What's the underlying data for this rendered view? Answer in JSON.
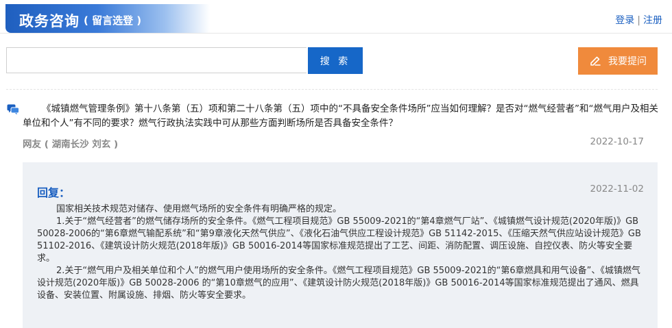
{
  "header": {
    "title": "政务咨询",
    "subtitle": "( 留言选登 )",
    "login": "登录",
    "separator": "|",
    "register": "注册"
  },
  "search": {
    "placeholder": "",
    "button_label": "搜 索"
  },
  "ask_button": {
    "label": "我要提问",
    "icon": "pencil-icon"
  },
  "question": {
    "icon": "chat-bubble-icon",
    "text": "《城镇燃气管理条例》第十八条第（五）项和第二十八条第（五）项中的“不具备安全条件场所”应当如何理解？是否对“燃气经营者”和“燃气用户及相关单位和个人”有不同的要求？燃气行政执法实践中可从那些方面判断场所是否具备安全条件？",
    "asker": "网友 ( 湖南长沙 刘玄 )",
    "date": "2022-10-17"
  },
  "reply": {
    "label": "回复：",
    "date": "2022-11-02",
    "paragraphs": [
      "国家相关技术规范对储存、使用燃气场所的安全条件有明确严格的规定。",
      "1.关于“燃气经营者”的燃气储存场所的安全条件。《燃气工程项目规范》GB 55009-2021的“第4章燃气厂站”、《城镇燃气设计规范(2020年版)》GB 50028-2006的“第6章燃气输配系统”和“第9章液化天然气供应”、《液化石油气供应工程设计规范》GB 51142-2015、《压缩天然气供应站设计规范》GB 51102-2016、《建筑设计防火规范(2018年版)》GB 50016-2014等国家标准规范提出了工艺、间距、消防配置、调压设施、自控仪表、防火等安全要求。",
      "2.关于“燃气用户及相关单位和个人”的燃气用户使用场所的安全条件。《燃气工程项目规范》GB 55009-2021的“第6章燃具和用气设备”、《城镇燃气设计规范(2020年版)》GB 50028-2006 的“第10章燃气的应用”、《建筑设计防火规范(2018年版)》GB 50016-2014等国家标准规范提出了通风、燃具设备、安装位置、附属设施、排烟、防火等安全要求。"
    ]
  },
  "colors": {
    "brand_blue": "#1667c8",
    "accent_orange": "#f08a3c",
    "reply_bg": "#eef1f5"
  }
}
